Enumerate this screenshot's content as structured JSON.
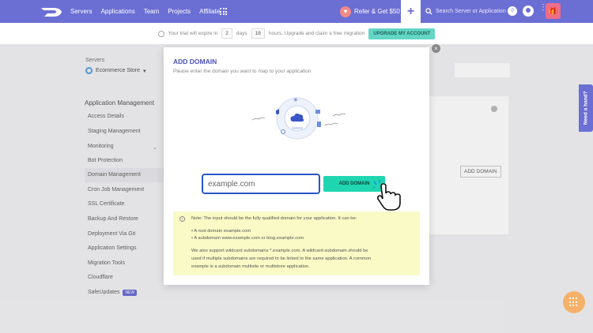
{
  "nav": {
    "links": [
      "Servers",
      "Applications",
      "Team",
      "Projects",
      "Affiliate"
    ],
    "refer_label": "Refer & Get $50",
    "search_placeholder": "Search Server or Application",
    "count": "0"
  },
  "trial": {
    "text1": "Your trial will expire in",
    "days_value": "2",
    "days_label": "days",
    "hours_value": "18",
    "hours_text": "hours. Upgrade and claim a free migration",
    "upgrade_label": "UPGRADE MY ACCOUNT"
  },
  "sidebar": {
    "servers_label": "Servers",
    "server_name": "Ecommerce Store",
    "section_title": "Application Management",
    "items": [
      "Access Details",
      "Staging Management",
      "Monitoring",
      "Bot Protection",
      "Domain Management",
      "Cron Job Management",
      "SSL Certificate",
      "Backup And Restore",
      "Deployment Via Git",
      "Application Settings",
      "Migration Tools",
      "Cloudflare",
      "SafeUpdates"
    ],
    "new_badge": "NEW"
  },
  "background": {
    "add_domain_label": "ADD DOMAIN"
  },
  "help": {
    "need_hand": "Need a hand?"
  },
  "modal": {
    "title": "ADD DOMAIN",
    "subtitle": "Please enter the domain you want to map to your application",
    "input_placeholder": "example.com",
    "button_label": "ADD DOMAIN",
    "note_intro": "Note: The input should be the fully qualified domain for your application. It can be:",
    "bullets": [
      "A root domain example.com",
      "A subdomain www.example.com or blog.example.com"
    ],
    "wildcard_lines": [
      "We also support wildcard subdomains *.example.com. A wildcard subdomain should be",
      "used if multiple subdomains are required to be linked to the same application. A common",
      "example is a subdomain multisite or multistore application."
    ]
  },
  "colors": {
    "brand": "#6b6fd4",
    "accent": "#1fd6b0",
    "note_bg": "#f9fac5"
  }
}
